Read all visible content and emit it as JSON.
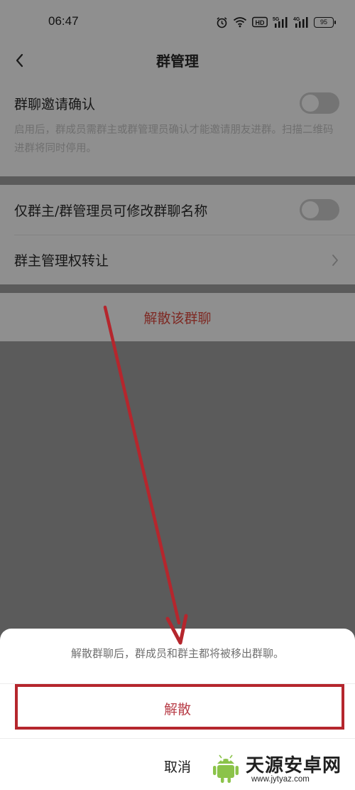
{
  "status_bar": {
    "time": "06:47",
    "battery": "95",
    "icons": [
      "alarm-icon",
      "wifi-icon",
      "hd-icon",
      "signal-5g-icon",
      "signal-4g-icon",
      "battery-icon"
    ],
    "labels": {
      "hd": "HD",
      "net1": "5G",
      "net2": "4G"
    }
  },
  "header": {
    "title": "群管理",
    "back_icon": "chevron-left-icon"
  },
  "settings": {
    "invite_confirm": {
      "label": "群聊邀请确认",
      "description": "启用后，群成员需群主或群管理员确认才能邀请朋友进群。扫描二维码进群将同时停用。",
      "enabled": false
    },
    "only_admin_rename": {
      "label": "仅群主/群管理员可修改群聊名称",
      "enabled": false
    },
    "transfer_owner": {
      "label": "群主管理权转让"
    },
    "disband": {
      "label": "解散该群聊"
    }
  },
  "sheet": {
    "message": "解散群聊后，群成员和群主都将被移出群聊。",
    "confirm_label": "解散",
    "cancel_label": "取消"
  },
  "watermark": {
    "name": "天源安卓网",
    "url": "www.jytyaz.com"
  },
  "colors": {
    "danger": "#b9404a",
    "annotation": "#b5262d",
    "overlay_bg": "#5b5b5b"
  }
}
